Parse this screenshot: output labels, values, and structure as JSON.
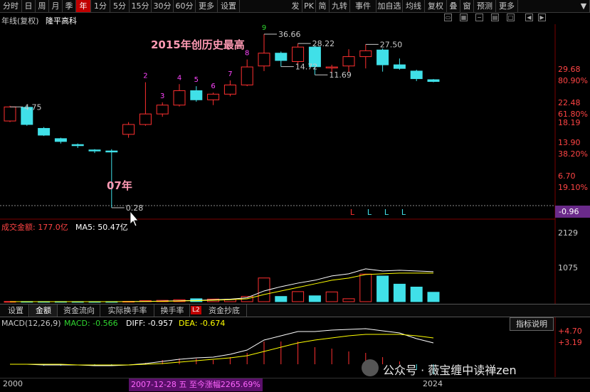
{
  "toolbar": {
    "left": [
      "分时",
      "日",
      "周",
      "月",
      "季",
      "年",
      "1分",
      "5分",
      "15分",
      "30分",
      "60分",
      "更多",
      "设置"
    ],
    "right": [
      "发",
      "PK",
      "简",
      "九转",
      "事件",
      "加自选",
      "均线",
      "复权",
      "叠",
      "窗",
      "预测",
      "更多"
    ]
  },
  "header": {
    "title": "年线(复权)",
    "stock_name": "隆平高科"
  },
  "annotations": {
    "record": "2015年创历史最高",
    "year07": "07年"
  },
  "chart_data": {
    "type": "candlestick",
    "period": "yearly",
    "candles": [
      {
        "open": 3.2,
        "close": 4.75,
        "high": 4.9,
        "low": 3.1,
        "up": true
      },
      {
        "open": 4.7,
        "close": 2.9,
        "high": 4.9,
        "low": 2.8,
        "up": false
      },
      {
        "open": 2.6,
        "close": 2.15,
        "high": 2.7,
        "low": 2.1,
        "up": false
      },
      {
        "open": 1.95,
        "close": 1.8,
        "high": 2.0,
        "low": 1.7,
        "up": false
      },
      {
        "open": 1.65,
        "close": 1.6,
        "high": 1.7,
        "low": 1.5,
        "up": false
      },
      {
        "open": 1.4,
        "close": 1.42,
        "high": 1.45,
        "low": 1.3,
        "up": false
      },
      {
        "open": 1.35,
        "close": 1.38,
        "high": 1.45,
        "low": 0.28,
        "up": false
      },
      {
        "open": 2.2,
        "close": 2.9,
        "high": 3.1,
        "low": 2.0,
        "up": true
      },
      {
        "open": 2.9,
        "close": 3.9,
        "high": 9.5,
        "low": 2.8,
        "up": true
      },
      {
        "open": 3.9,
        "close": 5.0,
        "high": 5.4,
        "low": 3.6,
        "up": true
      },
      {
        "open": 5.0,
        "close": 7.5,
        "high": 9.0,
        "low": 4.8,
        "up": true
      },
      {
        "open": 7.5,
        "close": 5.8,
        "high": 8.5,
        "low": 5.5,
        "up": false
      },
      {
        "open": 5.8,
        "close": 6.8,
        "high": 7.1,
        "low": 5.0,
        "up": true
      },
      {
        "open": 6.8,
        "close": 8.8,
        "high": 10.0,
        "low": 6.4,
        "up": true
      },
      {
        "open": 8.8,
        "close": 14.6,
        "high": 18.0,
        "low": 8.5,
        "up": true
      },
      {
        "open": 15.0,
        "close": 21.5,
        "high": 36.66,
        "low": 13.0,
        "up": true
      },
      {
        "open": 21.5,
        "close": 17.5,
        "high": 22.5,
        "low": 14.72,
        "up": false
      },
      {
        "open": 17.0,
        "close": 25.5,
        "high": 28.22,
        "low": 14.7,
        "up": true
      },
      {
        "open": 25.5,
        "close": 14.7,
        "high": 26.5,
        "low": 11.69,
        "up": false
      },
      {
        "open": 14.5,
        "close": 14.6,
        "high": 15.5,
        "low": 12.0,
        "up": true
      },
      {
        "open": 15.0,
        "close": 19.5,
        "high": 24.0,
        "low": 12.5,
        "up": true
      },
      {
        "open": 19.5,
        "close": 23.0,
        "high": 27.5,
        "low": 14.0,
        "up": true
      },
      {
        "open": 23.5,
        "close": 15.5,
        "high": 24.5,
        "low": 12.8,
        "up": false
      },
      {
        "open": 15.5,
        "close": 14.0,
        "high": 18.5,
        "low": 13.5,
        "up": false
      },
      {
        "open": 13.0,
        "close": 10.5,
        "high": 13.5,
        "low": 9.8,
        "up": false
      },
      {
        "open": 10.2,
        "close": 9.7,
        "high": 10.4,
        "low": 9.5,
        "up": false
      }
    ],
    "labels": {
      "high_2015": "36.66",
      "low_start": "4.75",
      "low_2005": "0.28",
      "point_1": "28.22",
      "point_2": "27.50",
      "point_3": "14.72",
      "point_4": "11.69"
    },
    "seq_numbers": [
      "2",
      "3",
      "4",
      "5",
      "6",
      "7",
      "8",
      "9"
    ],
    "signals": [
      "L",
      "L",
      "L",
      "L"
    ],
    "price_axis": [
      {
        "text": "29.68",
        "color": "#ff4444"
      },
      {
        "text": "80.90%",
        "color": "#ff4444"
      },
      {
        "text": "22.48",
        "color": "#ff4444"
      },
      {
        "text": "61.80%",
        "color": "#ff4444"
      },
      {
        "text": "18.19",
        "color": "#ff4444"
      },
      {
        "text": "13.90",
        "color": "#ff4444"
      },
      {
        "text": "38.20%",
        "color": "#ff4444"
      },
      {
        "text": "6.70",
        "color": "#ff4444"
      },
      {
        "text": "19.10%",
        "color": "#ff4444"
      }
    ],
    "right_badge": "-0.96",
    "volume": {
      "title": "成交金额: 177.0亿",
      "ma5": "MA5: 50.47亿",
      "axis": [
        "2129",
        "1075"
      ],
      "values": [
        5,
        4,
        3,
        3,
        2,
        2,
        2,
        8,
        30,
        40,
        60,
        90,
        80,
        70,
        160,
        730,
        160,
        310,
        180,
        300,
        90,
        850,
        790,
        540,
        450,
        290,
        40
      ]
    },
    "tabs": [
      "设置",
      "金额",
      "资金流向",
      "实际换手率",
      "换手率",
      "资金抄底"
    ],
    "tab_badge": "L2",
    "macd": {
      "title": "MACD(12,26,9)",
      "macd": "MACD: -0.566",
      "diff": "DIFF: -0.957",
      "dea": "DEA: -0.674",
      "axis": [
        "+4.70",
        "+3.19"
      ],
      "help": "指标说明"
    },
    "bottom": {
      "start": "2000",
      "info": "2007-12-28 五 至今涨幅2265.69%",
      "end": "2024"
    }
  },
  "watermark": "公众号 · 薇宝缠中读禅zen",
  "colors": {
    "up": "#ff3030",
    "down": "#40e0e8",
    "seq": "#ff44ff",
    "label_pink": "#ff9ab4",
    "white": "#ffffff",
    "yellow": "#ffff00"
  }
}
